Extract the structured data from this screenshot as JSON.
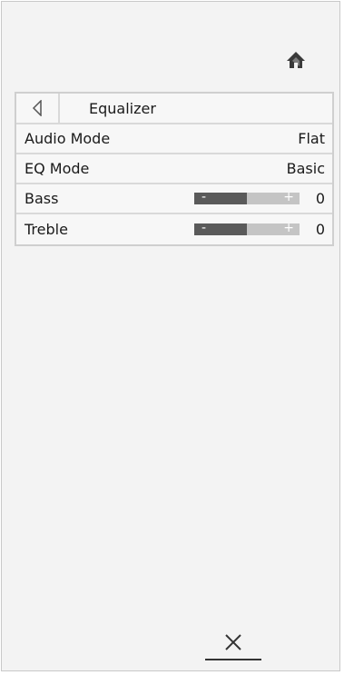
{
  "header": {
    "home_icon": "home-icon"
  },
  "menu": {
    "back_icon": "triangle-left-icon",
    "title": "Equalizer",
    "rows": [
      {
        "label": "Audio Mode",
        "value": "Flat"
      },
      {
        "label": "EQ Mode",
        "value": "Basic"
      }
    ],
    "sliders": [
      {
        "label": "Bass",
        "minus": "-",
        "plus": "+",
        "value": "0",
        "level_fraction": 0.5
      },
      {
        "label": "Treble",
        "minus": "-",
        "plus": "+",
        "value": "0",
        "level_fraction": 0.5
      }
    ]
  },
  "footer": {
    "close_icon": "close-icon"
  },
  "colors": {
    "panel_background": "#f3f3f3",
    "border": "#cfcfcf",
    "slider_fill": "#5a5a5a",
    "slider_track": "#c4c4c4",
    "icon": "#333333"
  }
}
